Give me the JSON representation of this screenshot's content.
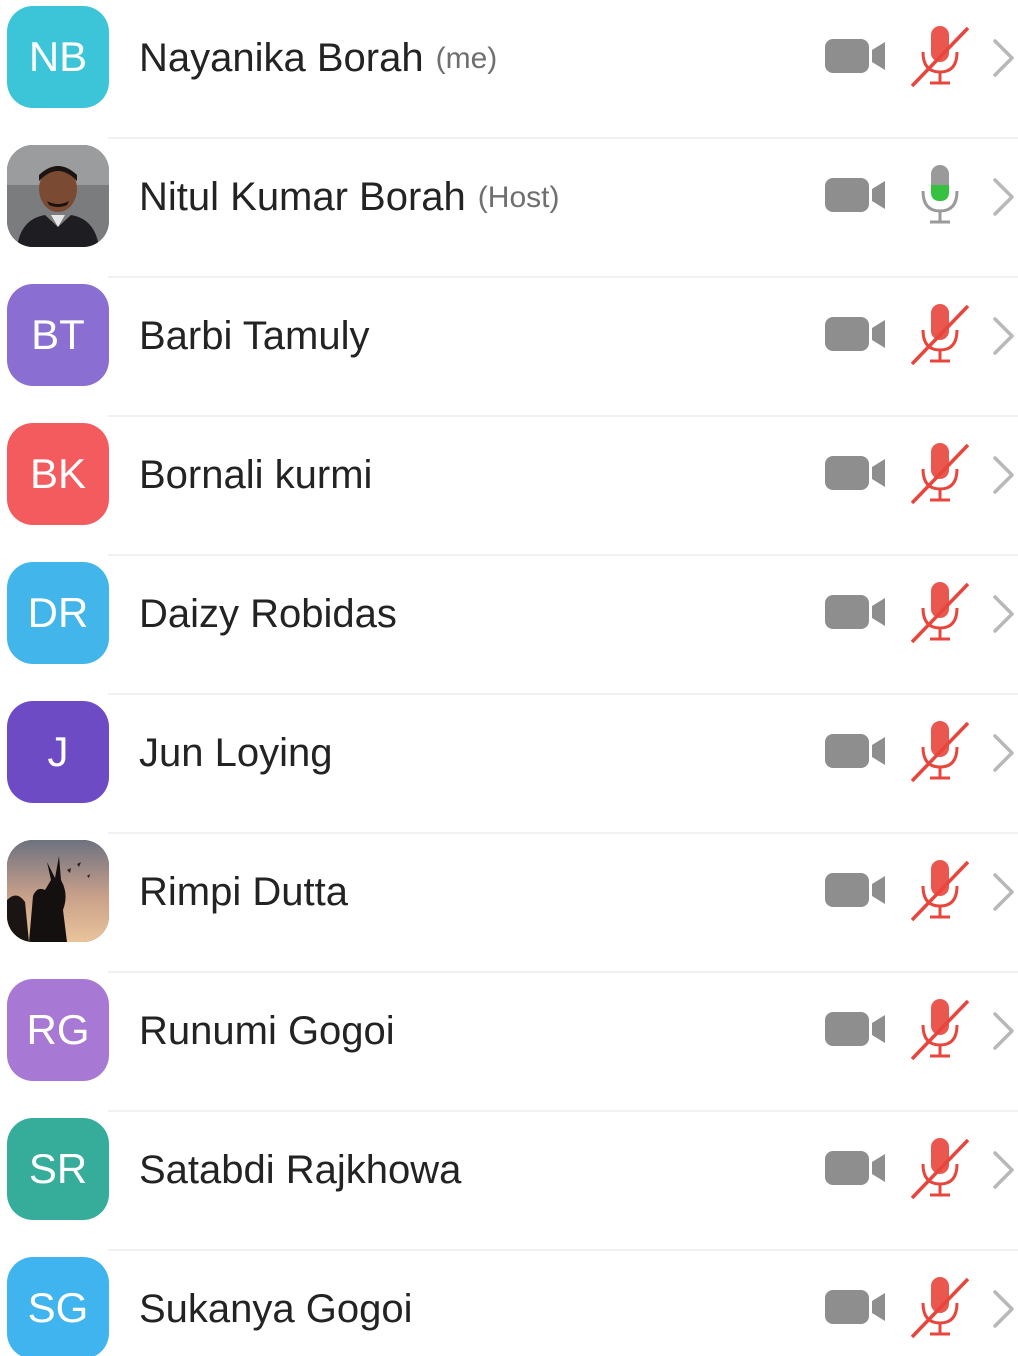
{
  "participants": [
    {
      "initials": "NB",
      "name": "Nayanika Borah",
      "tag": "(me)",
      "avatar_color": "#3cc5d8",
      "avatar_type": "initials",
      "mic": "muted"
    },
    {
      "initials": "",
      "name": "Nitul Kumar Borah",
      "tag": "(Host)",
      "avatar_color": "#6b6b6b",
      "avatar_type": "photo-man",
      "mic": "active"
    },
    {
      "initials": "BT",
      "name": "Barbi Tamuly",
      "tag": "",
      "avatar_color": "#8a6ed1",
      "avatar_type": "initials",
      "mic": "muted"
    },
    {
      "initials": "BK",
      "name": "Bornali kurmi",
      "tag": "",
      "avatar_color": "#f45b5f",
      "avatar_type": "initials",
      "mic": "muted"
    },
    {
      "initials": "DR",
      "name": "Daizy Robidas",
      "tag": "",
      "avatar_color": "#42b6ea",
      "avatar_type": "initials",
      "mic": "muted"
    },
    {
      "initials": "J",
      "name": "Jun Loying",
      "tag": "",
      "avatar_color": "#6c4bc4",
      "avatar_type": "initials",
      "mic": "muted"
    },
    {
      "initials": "",
      "name": "Rimpi Dutta",
      "tag": "",
      "avatar_color": "#3a3535",
      "avatar_type": "photo-silhouette",
      "mic": "muted"
    },
    {
      "initials": "RG",
      "name": "Runumi Gogoi",
      "tag": "",
      "avatar_color": "#a779d4",
      "avatar_type": "initials",
      "mic": "muted"
    },
    {
      "initials": "SR",
      "name": "Satabdi Rajkhowa",
      "tag": "",
      "avatar_color": "#36ad9a",
      "avatar_type": "initials",
      "mic": "muted"
    },
    {
      "initials": "SG",
      "name": "Sukanya Gogoi",
      "tag": "",
      "avatar_color": "#3fb4ee",
      "avatar_type": "initials",
      "mic": "muted"
    }
  ],
  "icons": {
    "video": "video-camera-icon",
    "mic_muted": "mic-muted-icon",
    "mic_active": "mic-active-icon",
    "chevron": "chevron-right-icon"
  },
  "colors": {
    "video_gray": "#8e8e8e",
    "muted_red": "#e8453c",
    "mic_green": "#36c23e",
    "mic_gray": "#9a9a9a",
    "chevron_gray": "#b8b8b8"
  }
}
